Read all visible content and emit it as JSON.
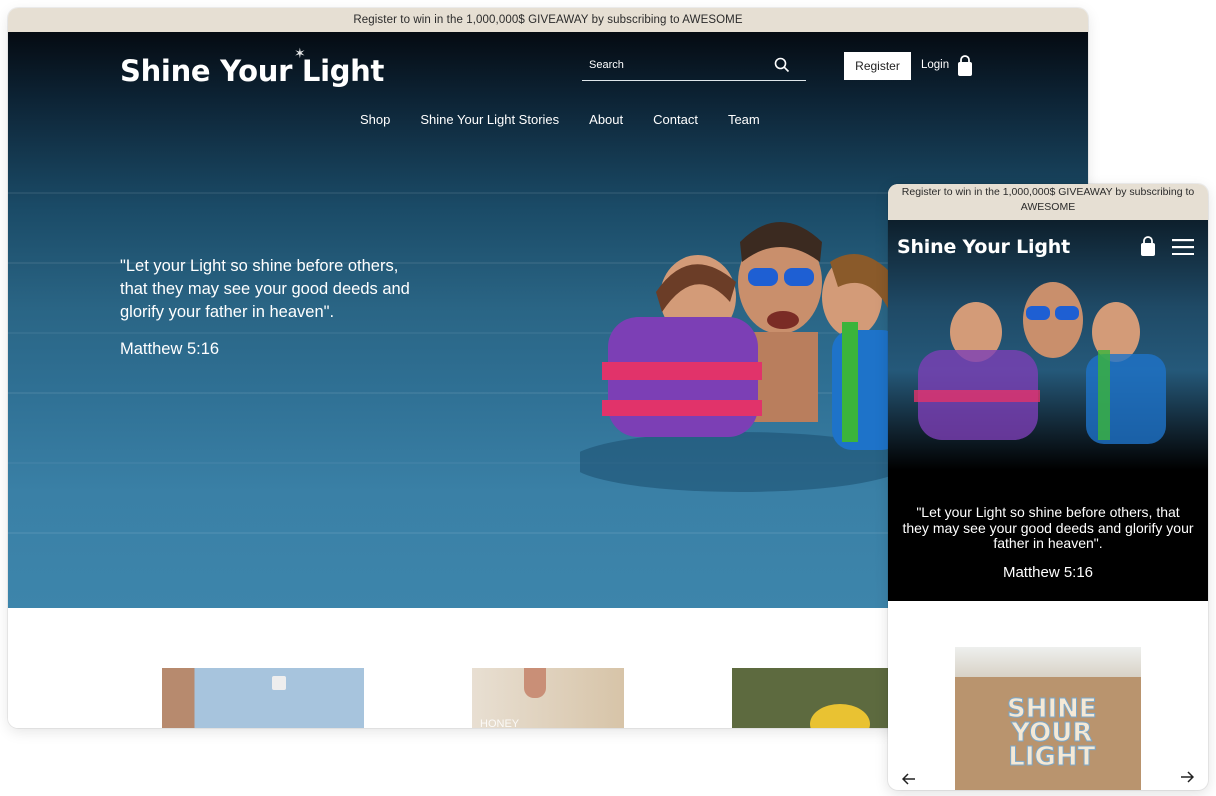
{
  "desktop": {
    "announcement": "Register to win in the 1,000,000$ GIVEAWAY by subscribing to AWESOME",
    "logo": "Shine Your Light",
    "search": {
      "placeholder": "Search"
    },
    "register_label": "Register",
    "login_label": "Login",
    "nav": [
      "Shop",
      "Shine Your Light Stories",
      "About",
      "Contact",
      "Team"
    ],
    "quote": "\"Let your Light so shine before others, that they may see your good deeds and glorify your father in heaven\".",
    "citation": "Matthew 5:16",
    "product_text": "HONEY"
  },
  "mobile": {
    "announcement": "Register to win in the 1,000,000$ GIVEAWAY by subscribing to AWESOME",
    "logo": "Shine Your Light",
    "quote": "\"Let your Light so shine before others, that they may see your good deeds and glorify your father in heaven\".",
    "citation": "Matthew 5:16",
    "sticker_text": [
      "SHINE",
      "YOUR",
      "LIGHT"
    ]
  },
  "icons": {
    "search": "search-icon",
    "bag": "shopping-bag-icon",
    "menu": "hamburger-menu-icon",
    "prev": "arrow-left-icon",
    "next": "arrow-right-icon"
  },
  "colors": {
    "announcement_bg": "#e6dfd3",
    "hero_water": "#2f7094",
    "button_bg": "#ffffff",
    "text_on_hero": "#ffffff"
  }
}
